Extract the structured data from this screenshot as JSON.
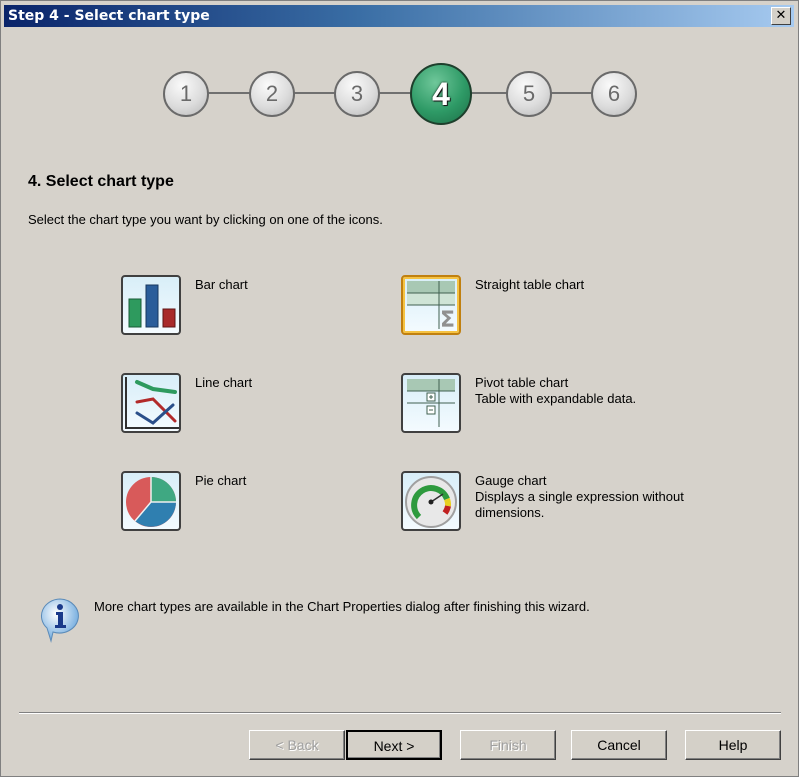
{
  "window": {
    "title": "Step 4 - Select chart type",
    "close_label": "✕"
  },
  "wizard": {
    "steps": [
      {
        "label": "1",
        "state": "done"
      },
      {
        "label": "2",
        "state": "done"
      },
      {
        "label": "3",
        "state": "done"
      },
      {
        "label": "4",
        "state": "current"
      },
      {
        "label": "5",
        "state": "pending"
      },
      {
        "label": "6",
        "state": "pending"
      }
    ],
    "current_step": 4,
    "active_color": "#2e9a66"
  },
  "page": {
    "heading": "4. Select chart type",
    "description": "Select the chart type you want by clicking on one of the icons."
  },
  "chart_types": [
    {
      "id": "bar",
      "icon": "bar-chart-icon",
      "title": "Bar chart",
      "subtitle": ""
    },
    {
      "id": "line",
      "icon": "line-chart-icon",
      "title": "Line chart",
      "subtitle": ""
    },
    {
      "id": "pie",
      "icon": "pie-chart-icon",
      "title": "Pie chart",
      "subtitle": ""
    },
    {
      "id": "straight-table",
      "icon": "straight-table-icon",
      "title": "Straight table chart",
      "subtitle": "",
      "selected": true
    },
    {
      "id": "pivot-table",
      "icon": "pivot-table-icon",
      "title": "Pivot table chart",
      "subtitle": "Table with expandable data."
    },
    {
      "id": "gauge",
      "icon": "gauge-chart-icon",
      "title": "Gauge chart",
      "subtitle": "Displays a single expression without dimensions."
    }
  ],
  "info": {
    "icon": "info-icon",
    "text": "More chart types are available in the Chart Properties dialog after finishing this wizard."
  },
  "buttons": {
    "back": {
      "label": "< Back",
      "enabled": false
    },
    "next": {
      "label": "Next >",
      "enabled": true,
      "default": true
    },
    "finish": {
      "label": "Finish",
      "enabled": false
    },
    "cancel": {
      "label": "Cancel",
      "enabled": true
    },
    "help": {
      "label": "Help",
      "enabled": true
    }
  }
}
